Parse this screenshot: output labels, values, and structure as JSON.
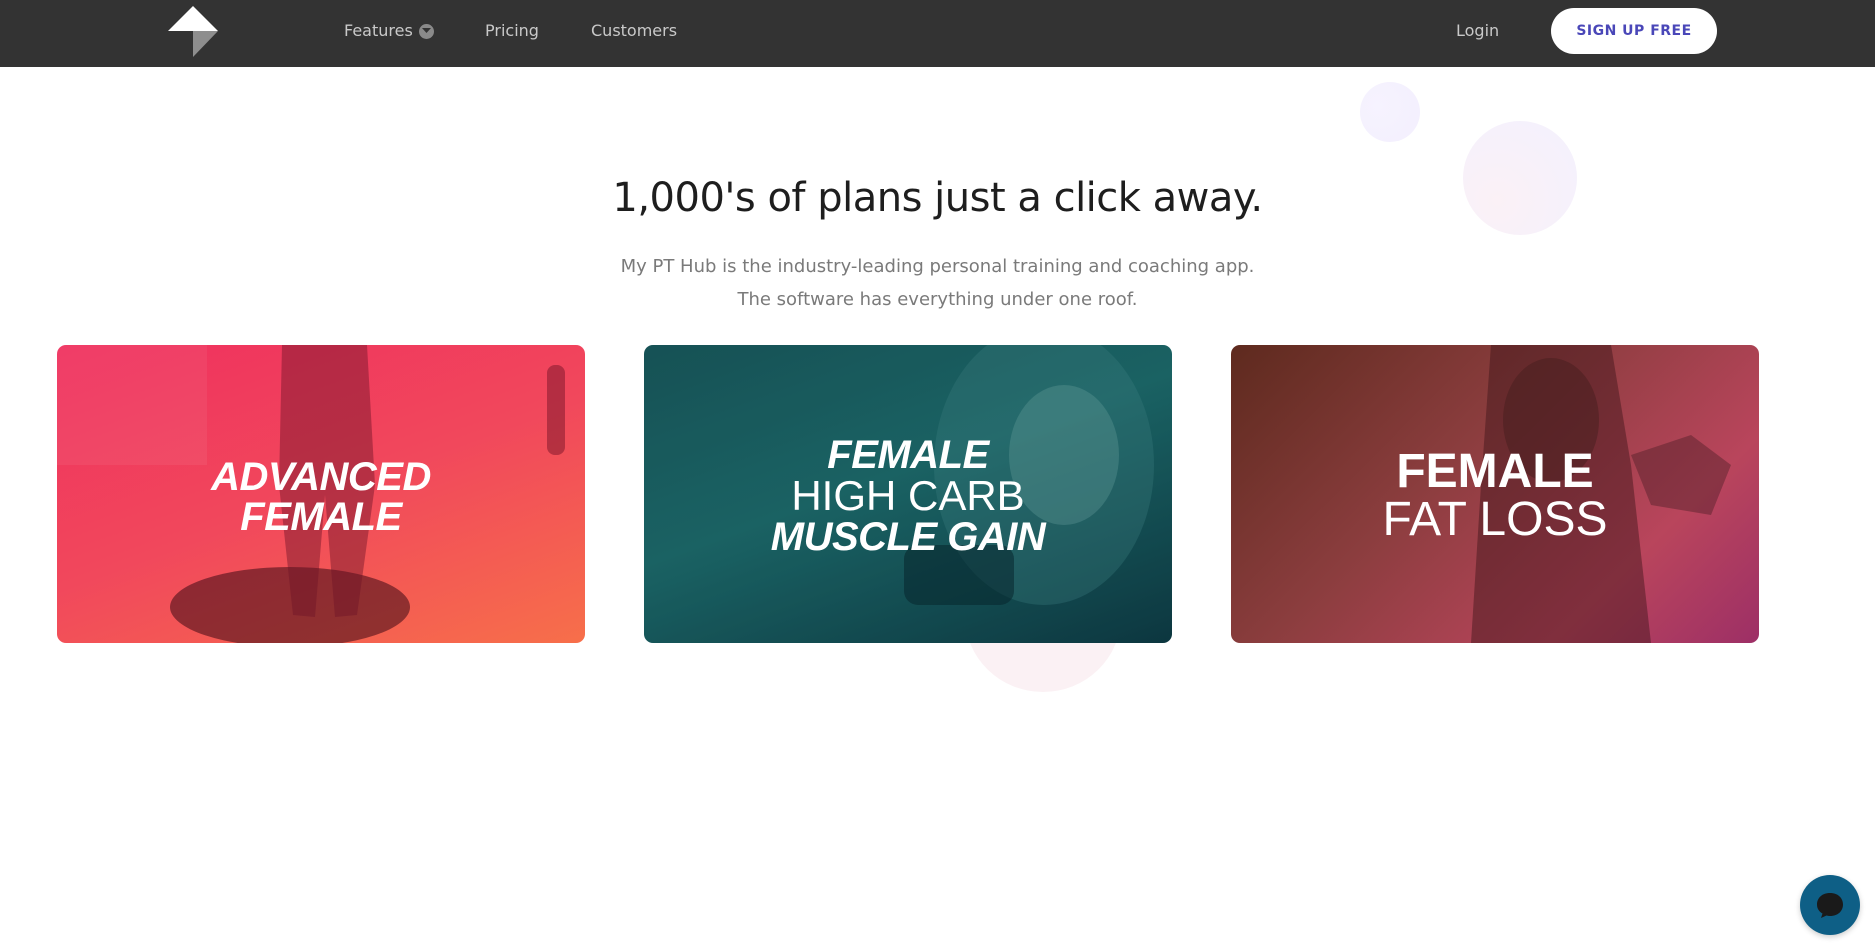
{
  "header": {
    "nav": {
      "features": "Features",
      "pricing": "Pricing",
      "customers": "Customers",
      "login": "Login"
    },
    "signup_label": "SIGN UP FREE"
  },
  "hero": {
    "title": "1,000's of plans just a click away.",
    "subtitle_line1": "My PT Hub is the industry-leading personal training and coaching app.",
    "subtitle_line2": "The software has everything under one roof."
  },
  "plans": [
    {
      "line1": "ADVANCED",
      "line2": "FEMALE"
    },
    {
      "line1": "FEMALE",
      "line2": "HIGH CARB",
      "line3": "MUSCLE GAIN"
    },
    {
      "line1": "FEMALE",
      "line2": "FAT LOSS"
    }
  ],
  "colors": {
    "header_bg": "#333333",
    "signup_text": "#4a47b8",
    "card1": "#f0305e",
    "card2": "#1f6f6e",
    "card3": "#8b3d3e",
    "chat": "#0e5f86"
  },
  "icons": {
    "logo": "brand-logo-icon",
    "features_caret": "chevron-down-icon",
    "chat": "chat-bubble-icon"
  }
}
